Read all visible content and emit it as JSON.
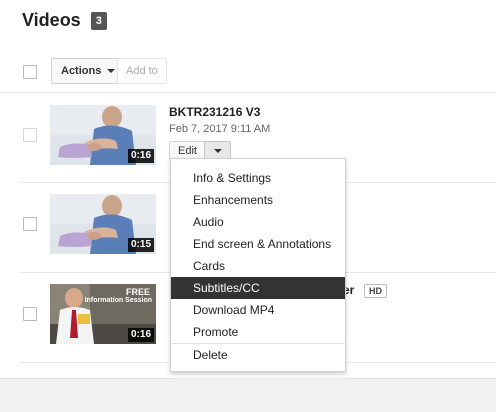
{
  "header": {
    "title": "Videos",
    "count": "3"
  },
  "toolbar": {
    "actions_label": "Actions",
    "add_to_label": "Add to"
  },
  "videos": [
    {
      "title": "BKTR231216 V3",
      "date": "Feb 7, 2017 9:11 AM",
      "duration": "0:16",
      "edit_label": "Edit"
    },
    {
      "title": "",
      "date": "",
      "duration": "0:15"
    },
    {
      "title_partial": "er",
      "hd_label": "HD",
      "duration": "0:16",
      "thumb_text": "FREE",
      "thumb_subtext": "Information Session"
    }
  ],
  "menu": {
    "items": [
      "Info & Settings",
      "Enhancements",
      "Audio",
      "End screen & Annotations",
      "Cards",
      "Subtitles/CC",
      "Download MP4",
      "Promote",
      "Delete"
    ],
    "selected": "Subtitles/CC"
  },
  "colors": {
    "selected_bg": "#333333",
    "badge_bg": "#555555"
  }
}
